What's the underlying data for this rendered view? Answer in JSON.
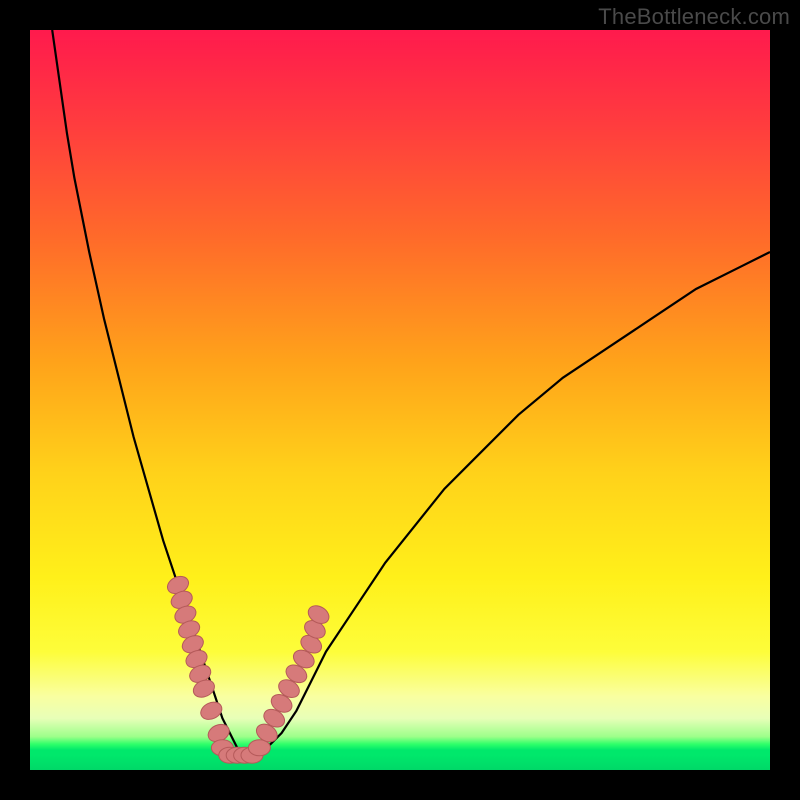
{
  "watermark": "TheBottleneck.com",
  "colors": {
    "frame": "#000000",
    "curve": "#000000",
    "marker_fill": "#d67a7a",
    "marker_stroke": "#b55a5a",
    "gradient_top": "#ff1a4d",
    "gradient_bottom": "#00d868"
  },
  "chart_data": {
    "type": "line",
    "title": "",
    "xlabel": "",
    "ylabel": "",
    "xlim": [
      0,
      100
    ],
    "ylim": [
      0,
      100
    ],
    "grid": false,
    "legend": false,
    "series": [
      {
        "name": "bottleneck-curve",
        "x": [
          3,
          4,
          5,
          6,
          8,
          10,
          12,
          14,
          16,
          18,
          20,
          21,
          22,
          23,
          24,
          25,
          26,
          27,
          28,
          29,
          30,
          32,
          34,
          36,
          38,
          40,
          44,
          48,
          52,
          56,
          60,
          66,
          72,
          78,
          84,
          90,
          96,
          100
        ],
        "y": [
          100,
          93,
          86,
          80,
          70,
          61,
          53,
          45,
          38,
          31,
          25,
          22,
          19,
          16,
          13,
          10,
          7,
          5,
          3,
          2,
          2,
          3,
          5,
          8,
          12,
          16,
          22,
          28,
          33,
          38,
          42,
          48,
          53,
          57,
          61,
          65,
          68,
          70
        ]
      }
    ],
    "markers": [
      {
        "name": "left-cluster",
        "x": [
          20,
          20.5,
          21,
          21.5,
          22,
          22.5,
          23,
          23.5,
          24.5,
          25.5
        ],
        "y": [
          25,
          23,
          21,
          19,
          17,
          15,
          13,
          11,
          8,
          5
        ]
      },
      {
        "name": "bottom-cluster",
        "x": [
          26,
          27,
          28,
          29,
          30,
          31
        ],
        "y": [
          3,
          2,
          2,
          2,
          2,
          3
        ]
      },
      {
        "name": "right-cluster",
        "x": [
          32,
          33,
          34,
          35,
          36,
          37,
          38,
          38.5,
          39
        ],
        "y": [
          5,
          7,
          9,
          11,
          13,
          15,
          17,
          19,
          21
        ]
      }
    ],
    "bottom_pill": {
      "x_start": 26.5,
      "x_end": 30.5,
      "y": 2
    }
  }
}
